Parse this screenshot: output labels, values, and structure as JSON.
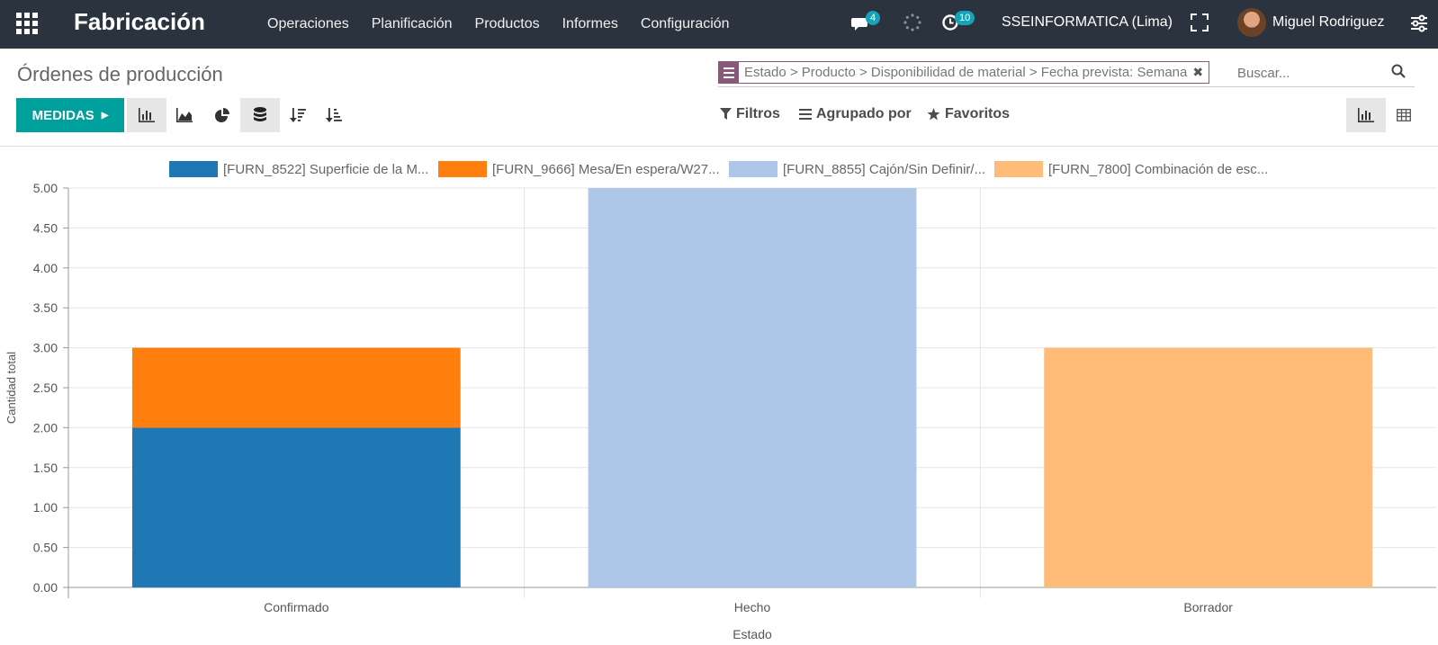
{
  "navbar": {
    "app_title": "Fabricación",
    "menu": [
      "Operaciones",
      "Planificación",
      "Productos",
      "Informes",
      "Configuración"
    ],
    "messages_count": "4",
    "activities_count": "10",
    "company": "SSEINFORMATICA (Lima)",
    "user": "Miguel Rodriguez"
  },
  "control": {
    "page_title": "Órdenes de producción",
    "facet_text": "Estado > Producto > Disponibilidad de material > Fecha prevista: Semana",
    "search_placeholder": "Buscar...",
    "measures_label": "MEDIDAS",
    "filters_label": "Filtros",
    "groupby_label": "Agrupado por",
    "favorites_label": "Favoritos"
  },
  "colors": {
    "navbar_bg": "#2b333e",
    "primary": "#00a09d",
    "facet": "#875a7b"
  },
  "chart_data": {
    "type": "bar",
    "stacked": true,
    "categories": [
      "Confirmado",
      "Hecho",
      "Borrador"
    ],
    "series": [
      {
        "name": "[FURN_8522] Superficie de la M...",
        "color": "#1f77b4",
        "values": [
          2,
          0,
          0
        ]
      },
      {
        "name": "[FURN_9666] Mesa/En espera/W27...",
        "color": "#ff7f0e",
        "values": [
          1,
          0,
          0
        ]
      },
      {
        "name": "[FURN_8855] Cajón/Sin Definir/...",
        "color": "#aec7e8",
        "values": [
          0,
          5,
          0
        ]
      },
      {
        "name": "[FURN_7800] Combinación de esc...",
        "color": "#ffbb78",
        "values": [
          0,
          0,
          3
        ]
      }
    ],
    "xlabel": "Estado",
    "ylabel": "Cantidad total",
    "ylim": [
      0,
      5
    ],
    "yticks": [
      "0.00",
      "0.50",
      "1.00",
      "1.50",
      "2.00",
      "2.50",
      "3.00",
      "3.50",
      "4.00",
      "4.50",
      "5.00"
    ],
    "grid": true,
    "legend_position": "top"
  }
}
